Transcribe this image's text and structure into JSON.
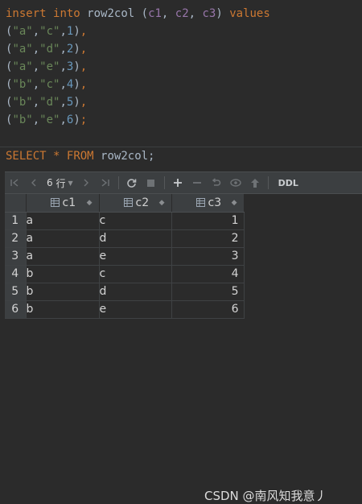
{
  "editor": {
    "insert_line": {
      "kw1": "insert",
      "kw2": "into",
      "table": "row2col",
      "cols": [
        "c1",
        "c2",
        "c3"
      ],
      "kw3": "values"
    },
    "value_rows": [
      {
        "a": "\"a\"",
        "b": "\"c\"",
        "n": "1",
        "end": ","
      },
      {
        "a": "\"a\"",
        "b": "\"d\"",
        "n": "2",
        "end": ","
      },
      {
        "a": "\"a\"",
        "b": "\"e\"",
        "n": "3",
        "end": ","
      },
      {
        "a": "\"b\"",
        "b": "\"c\"",
        "n": "4",
        "end": ","
      },
      {
        "a": "\"b\"",
        "b": "\"d\"",
        "n": "5",
        "end": ","
      },
      {
        "a": "\"b\"",
        "b": "\"e\"",
        "n": "6",
        "end": ";"
      }
    ],
    "select_line": {
      "kw1": "SELECT",
      "star": "*",
      "kw2": "FROM",
      "table": "row2col;"
    }
  },
  "toolbar": {
    "page_count": "6",
    "page_unit": "行",
    "ddl_label": "DDL",
    "icons": [
      "first-page-icon",
      "prev-page-icon",
      "next-page-icon",
      "last-page-icon",
      "refresh-icon",
      "stop-icon",
      "add-row-icon",
      "delete-row-icon",
      "revert-icon",
      "preview-icon",
      "submit-icon"
    ]
  },
  "result_grid": {
    "columns": [
      "c1",
      "c2",
      "c3"
    ],
    "rows": [
      {
        "num": "1",
        "c1": "a",
        "c2": "c",
        "c3": "1"
      },
      {
        "num": "2",
        "c1": "a",
        "c2": "d",
        "c3": "2"
      },
      {
        "num": "3",
        "c1": "a",
        "c2": "e",
        "c3": "3"
      },
      {
        "num": "4",
        "c1": "b",
        "c2": "c",
        "c3": "4"
      },
      {
        "num": "5",
        "c1": "b",
        "c2": "d",
        "c3": "5"
      },
      {
        "num": "6",
        "c1": "b",
        "c2": "e",
        "c3": "6"
      }
    ]
  },
  "watermark": "CSDN @南风知我意丿",
  "colors": {
    "background": "#2b2b2b",
    "keyword": "#cc7832",
    "string": "#6a8759",
    "number": "#6897bb",
    "column": "#9876aa"
  }
}
